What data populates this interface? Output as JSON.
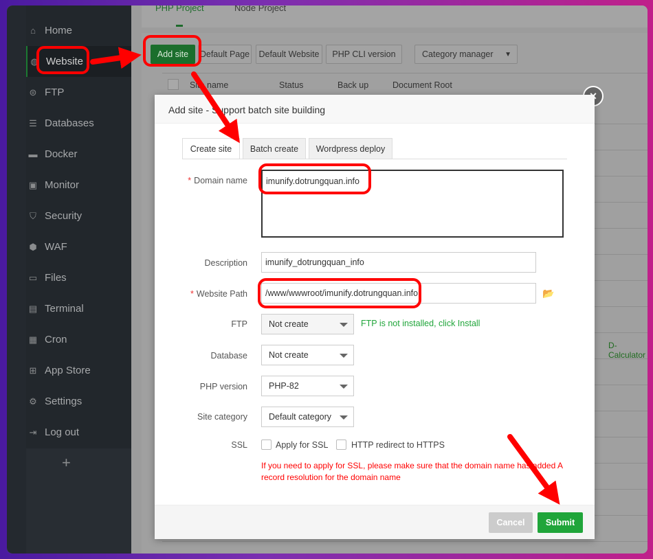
{
  "sidebar": {
    "items": [
      {
        "label": "Home",
        "icon": "home-icon"
      },
      {
        "label": "Website",
        "icon": "globe-icon",
        "active": true
      },
      {
        "label": "FTP",
        "icon": "ftp-icon"
      },
      {
        "label": "Databases",
        "icon": "database-icon"
      },
      {
        "label": "Docker",
        "icon": "docker-icon"
      },
      {
        "label": "Monitor",
        "icon": "monitor-icon"
      },
      {
        "label": "Security",
        "icon": "shield-icon"
      },
      {
        "label": "WAF",
        "icon": "waf-icon"
      },
      {
        "label": "Files",
        "icon": "folder-icon"
      },
      {
        "label": "Terminal",
        "icon": "terminal-icon"
      },
      {
        "label": "Cron",
        "icon": "calendar-icon"
      },
      {
        "label": "App Store",
        "icon": "apps-icon"
      },
      {
        "label": "Settings",
        "icon": "gear-icon"
      },
      {
        "label": "Log out",
        "icon": "logout-icon"
      }
    ],
    "add": "+"
  },
  "tabs": [
    "PHP Project",
    "Node Project"
  ],
  "toolbar": {
    "add_site": "Add site",
    "default_page": "Default Page",
    "default_website": "Default Website",
    "php_cli": "PHP CLI version",
    "category": "Category manager"
  },
  "table": {
    "headers": [
      "Site name",
      "Status",
      "Back up",
      "Document Root"
    ],
    "partial_cell": "D-Calculator"
  },
  "modal": {
    "title": "Add site - Support batch site building",
    "close": "×",
    "tabs": [
      "Create site",
      "Batch create",
      "Wordpress deploy"
    ],
    "domain_label": "Domain name",
    "domain_value": "imunify.dotrungquan.info",
    "description_label": "Description",
    "description_value": "imunify_dotrungquan_info",
    "path_label": "Website Path",
    "path_value": "/www/wwwroot/imunify.dotrungquan.info",
    "ftp_label": "FTP",
    "ftp_value": "Not create",
    "ftp_note": "FTP is not installed, click Install",
    "database_label": "Database",
    "database_value": "Not create",
    "php_label": "PHP version",
    "php_value": "PHP-82",
    "category_label": "Site category",
    "category_value": "Default category",
    "ssl_label": "SSL",
    "ssl_apply": "Apply for SSL",
    "ssl_redirect": "HTTP redirect to HTTPS",
    "ssl_note": "If you need to apply for SSL, please make sure that the domain name has added A record resolution for the domain name",
    "cancel": "Cancel",
    "submit": "Submit"
  },
  "colors": {
    "accent": "#20a53a",
    "annotation": "#ff0000",
    "note": "#ff0000"
  }
}
